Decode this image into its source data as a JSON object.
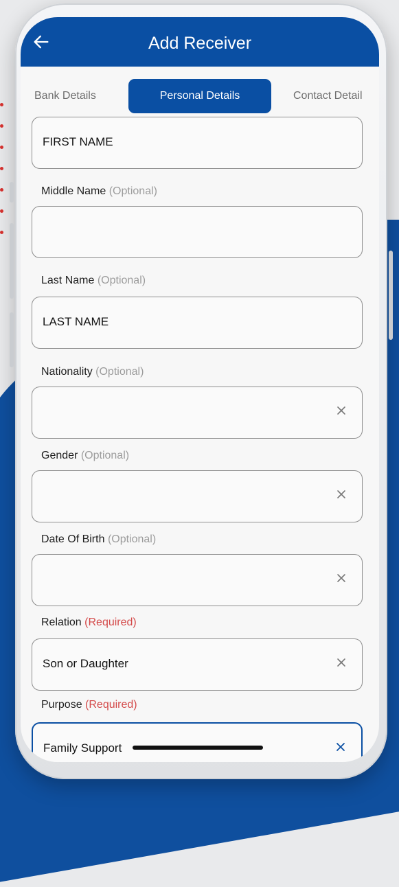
{
  "header": {
    "title": "Add Receiver"
  },
  "tabs": [
    {
      "label": "Bank Details"
    },
    {
      "label": "Personal Details"
    },
    {
      "label": "Contact Detail"
    }
  ],
  "form": {
    "first_name": {
      "value": "FIRST NAME"
    },
    "middle_name": {
      "label": "Middle Name",
      "tag": "(Optional)",
      "value": ""
    },
    "last_name": {
      "label": "Last Name",
      "tag": "(Optional)",
      "value": "LAST NAME"
    },
    "nationality": {
      "label": "Nationality",
      "tag": "(Optional)",
      "value": ""
    },
    "gender": {
      "label": "Gender",
      "tag": "(Optional)",
      "value": ""
    },
    "dob": {
      "label": "Date Of Birth",
      "tag": "(Optional)",
      "value": ""
    },
    "relation": {
      "label": "Relation",
      "tag": "(Required)",
      "value": "Son or Daughter"
    },
    "purpose": {
      "label": "Purpose",
      "tag": "(Required)",
      "value": "Family Support"
    }
  },
  "icons": {
    "back": "arrow-left-icon",
    "clear": "close-icon"
  },
  "colors": {
    "primary": "#0a4fa3",
    "required": "#d44a4a",
    "optional": "#9c9c9c"
  }
}
